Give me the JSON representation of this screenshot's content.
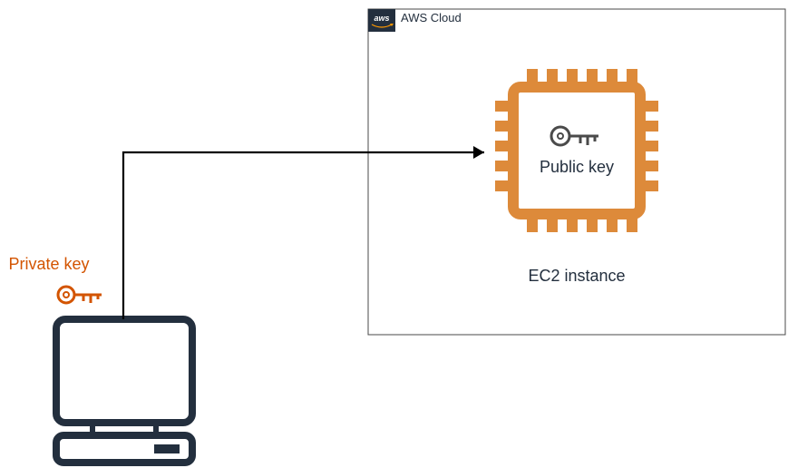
{
  "cloud": {
    "label": "AWS Cloud",
    "logo_text": "aws"
  },
  "client": {
    "private_key_label": "Private key"
  },
  "instance": {
    "public_key_label": "Public key",
    "caption": "EC2 instance"
  },
  "colors": {
    "navy": "#232f3e",
    "orange": "#dd6b10",
    "key_orange": "#d35400",
    "text_dark": "#232f3e",
    "border_gray": "#4a4a4a",
    "black": "#000000",
    "white": "#ffffff"
  }
}
